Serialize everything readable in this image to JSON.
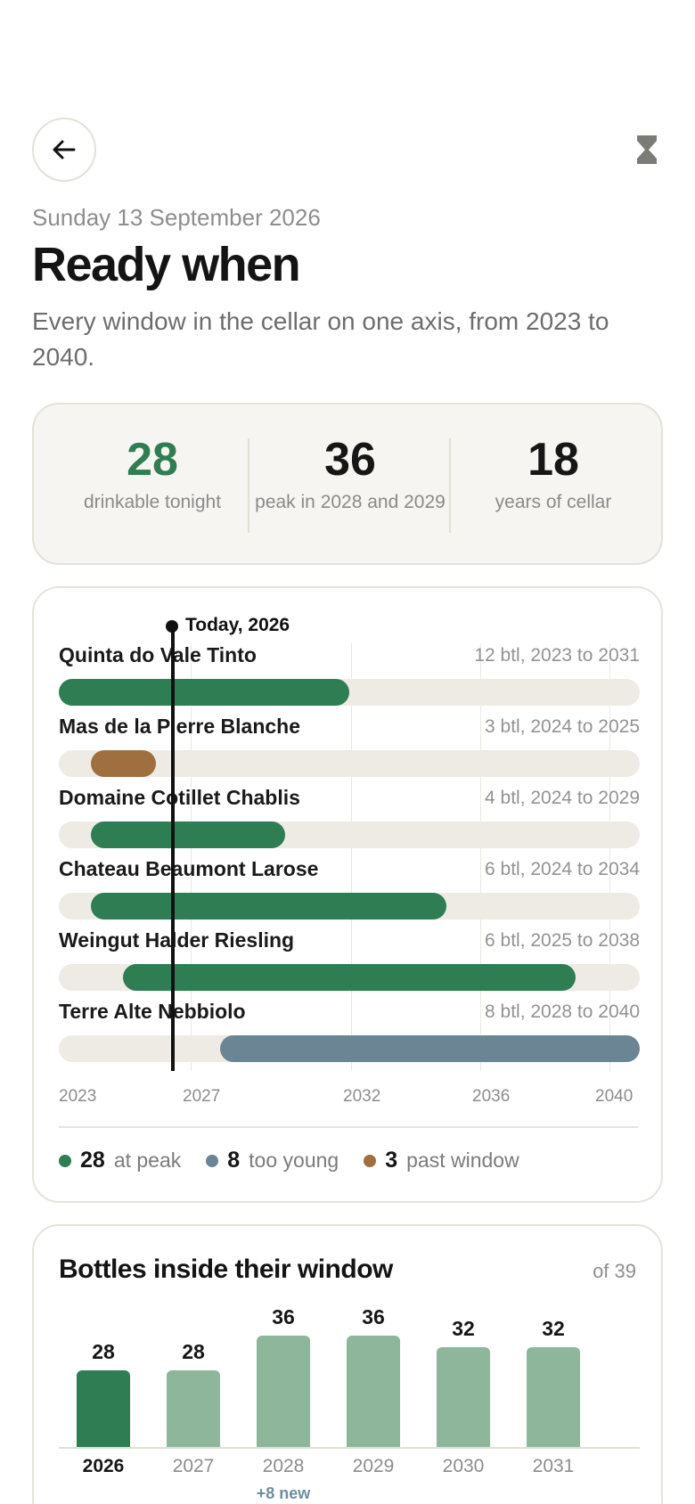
{
  "header": {
    "date": "Sunday 13 September 2026",
    "title": "Ready when",
    "subtitle": "Every window in the cellar on one axis, from 2023 to 2040."
  },
  "stats": [
    {
      "value": "28",
      "label": "drinkable tonight",
      "color": "#2f7d52"
    },
    {
      "value": "36",
      "label": "peak in 2028 and 2029",
      "color": "#161616"
    },
    {
      "value": "18",
      "label": "years of cellar",
      "color": "#161616"
    }
  ],
  "timeline": {
    "today_label": "Today, 2026",
    "today_year": 2026.5,
    "axis_start": 2023,
    "axis_end": 2041,
    "axis_ticks": [
      "2023",
      "2027",
      "2032",
      "2036",
      "2040"
    ],
    "wines": [
      {
        "name": "Quinta do Vale Tinto",
        "meta": "12 btl, 2023 to 2031",
        "from": 2023,
        "to": 2032,
        "status": "peak"
      },
      {
        "name": "Mas de la Pierre Blanche",
        "meta": "3 btl, 2024 to 2025",
        "from": 2024,
        "to": 2026,
        "status": "past"
      },
      {
        "name": "Domaine Cotillet Chablis",
        "meta": "4 btl, 2024 to 2029",
        "from": 2024,
        "to": 2030,
        "status": "peak"
      },
      {
        "name": "Chateau Beaumont Larose",
        "meta": "6 btl, 2024 to 2034",
        "from": 2024,
        "to": 2035,
        "status": "peak"
      },
      {
        "name": "Weingut Halder Riesling",
        "meta": "6 btl, 2025 to 2038",
        "from": 2025,
        "to": 2039,
        "status": "peak"
      },
      {
        "name": "Terre Alte Nebbiolo",
        "meta": "8 btl, 2028 to 2040",
        "from": 2028,
        "to": 2041,
        "status": "young"
      }
    ],
    "legend": [
      {
        "count": "28",
        "label": "at peak",
        "color": "#2f7d52"
      },
      {
        "count": "8",
        "label": "too young",
        "color": "#6c8595"
      },
      {
        "count": "3",
        "label": "past window",
        "color": "#9f6f40"
      }
    ]
  },
  "colors": {
    "peak": "#2f7d52",
    "young": "#6c8595",
    "past": "#9f6f40",
    "current_bar": "#2f7d52",
    "future_bar": "#8db69b"
  },
  "bottles": {
    "title": "Bottles inside their window",
    "of_label": "of 39",
    "max": 39,
    "columns": [
      {
        "year": "2026",
        "value": "28",
        "current": true,
        "note": ""
      },
      {
        "year": "2027",
        "value": "28",
        "current": false,
        "note": ""
      },
      {
        "year": "2028",
        "value": "36",
        "current": false,
        "note": "+8 new"
      },
      {
        "year": "2029",
        "value": "36",
        "current": false,
        "note": ""
      },
      {
        "year": "2030",
        "value": "32",
        "current": false,
        "note": ""
      },
      {
        "year": "2031",
        "value": "32",
        "current": false,
        "note": ""
      }
    ]
  },
  "chart_data": [
    {
      "type": "bar",
      "title": "Bottles inside their window",
      "categories": [
        "2026",
        "2027",
        "2028",
        "2029",
        "2030",
        "2031"
      ],
      "values": [
        28,
        28,
        36,
        36,
        32,
        32
      ],
      "annotations": [
        "of 39",
        "+8 new"
      ]
    },
    {
      "type": "bar",
      "title": "",
      "orientation": "horizontal-range",
      "categories": [
        "Quinta do Vale Tinto",
        "Mas de la Pierre Blanche",
        "Domaine Cotillet Chablis",
        "Chateau Beaumont Larose",
        "Weingut Halder Riesling",
        "Terre Alte Nebbiolo"
      ],
      "ranges": [
        [
          2023,
          2031
        ],
        [
          2024,
          2025
        ],
        [
          2024,
          2029
        ],
        [
          2024,
          2034
        ],
        [
          2025,
          2038
        ],
        [
          2028,
          2040
        ]
      ],
      "xlim": [
        2023,
        2040
      ],
      "annotations": [
        "Today, 2026"
      ]
    }
  ]
}
